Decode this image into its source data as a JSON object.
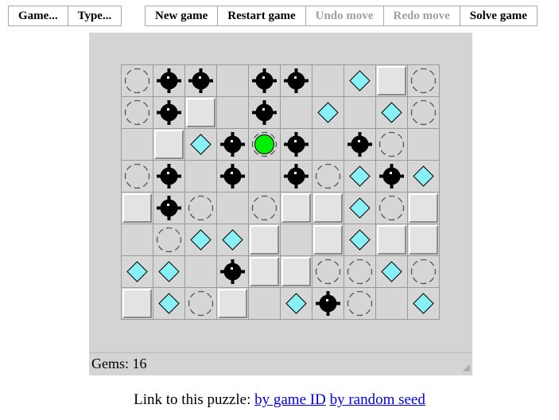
{
  "toolbar_left": [
    "Game...",
    "Type..."
  ],
  "toolbar_right": [
    {
      "label": "New game",
      "enabled": true
    },
    {
      "label": "Restart game",
      "enabled": true
    },
    {
      "label": "Undo move",
      "enabled": false
    },
    {
      "label": "Redo move",
      "enabled": false
    },
    {
      "label": "Solve game",
      "enabled": true
    }
  ],
  "status": {
    "text": "Gems: 16"
  },
  "footer": {
    "prefix": "Link to this puzzle:",
    "link_game_id": "by game ID",
    "link_random_seed": "by random seed"
  },
  "colors": {
    "gem": "#88f0f7",
    "player": "#00ee00",
    "mine": "#000000",
    "stop": "#555555"
  },
  "grid": {
    "rows": 8,
    "cols": 10,
    "legend": {
      ".": "empty",
      "W": "wall",
      "M": "mine",
      "G": "gem",
      "S": "stop",
      "P": "player"
    },
    "cells": [
      "SMM.MM.GWS",
      "SMW.M.G.GS",
      ".WGMPM.MS.",
      "SM.M.MSGMG",
      "WMS.SWWGSW",
      ".SGGW.WGWW",
      "GG.MWWSSGS",
      "WGSW.GMS.G"
    ]
  }
}
